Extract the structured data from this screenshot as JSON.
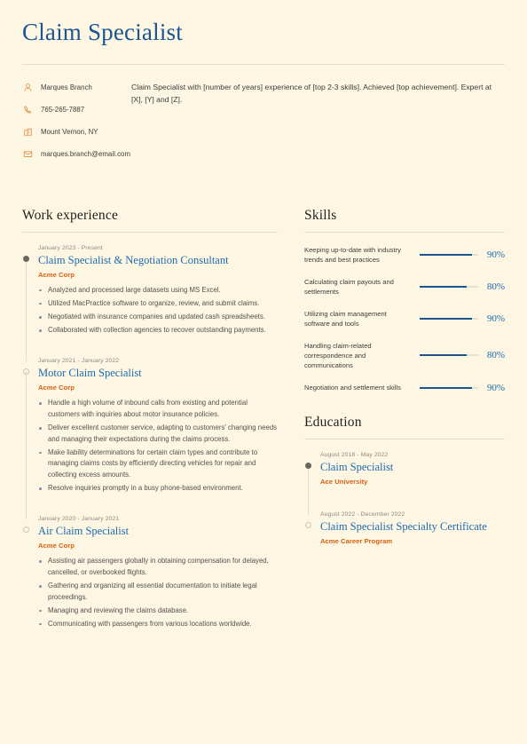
{
  "header": {
    "title": "Claim Specialist",
    "summary": "Claim Specialist with [number of years] experience of [top 2-3 skills]. Achieved [top achievement]. Expert at [X], [Y] and [Z].",
    "contacts": [
      {
        "icon": "person-icon",
        "text": "Marques Branch"
      },
      {
        "icon": "phone-icon",
        "text": "765-265-7887"
      },
      {
        "icon": "location-icon",
        "text": "Mount Vernon, NY"
      },
      {
        "icon": "email-icon",
        "text": "marques.branch@email.com"
      }
    ]
  },
  "work_experience": {
    "heading": "Work experience",
    "entries": [
      {
        "date": "January 2023 - Present",
        "title": "Claim Specialist & Negotiation Consultant",
        "org": "Acme Corp",
        "points": [
          "Analyzed and processed large datasets using MS Excel.",
          "Utilized MacPractice software to organize, review, and submit claims.",
          "Negotiated with insurance companies and updated cash spreadsheets.",
          "Collaborated with collection agencies to recover outstanding payments."
        ]
      },
      {
        "date": "January 2021 - January 2022",
        "title": "Motor Claim Specialist",
        "org": "Acme Corp",
        "points": [
          "Handle a high volume of inbound calls from existing and potential customers with inquiries about motor insurance policies.",
          "Deliver excellent customer service, adapting to customers' changing needs and managing their expectations during the claims process.",
          "Make liability determinations for certain claim types and contribute to managing claims costs by efficiently directing vehicles for repair and collecting excess amounts.",
          "Resolve inquiries promptly in a busy phone-based environment."
        ]
      },
      {
        "date": "January 2020 - January 2021",
        "title": "Air Claim Specialist",
        "org": "Acme Corp",
        "points": [
          "Assisting air passengers globally in obtaining compensation for delayed, cancelled, or overbooked flights.",
          "Gathering and organizing all essential documentation to initiate legal proceedings.",
          "Managing and reviewing the claims database.",
          "Communicating with passengers from various locations worldwide."
        ]
      }
    ]
  },
  "skills": {
    "heading": "Skills",
    "items": [
      {
        "name": "Keeping up-to-date with industry trends and best practices",
        "percent": "90%",
        "value": 90
      },
      {
        "name": "Calculating claim payouts and settlements",
        "percent": "80%",
        "value": 80
      },
      {
        "name": "Utilizing claim management software and tools",
        "percent": "90%",
        "value": 90
      },
      {
        "name": "Handling claim-related correspondence and communications",
        "percent": "80%",
        "value": 80
      },
      {
        "name": "Negotiation and settlement skills",
        "percent": "90%",
        "value": 90
      }
    ]
  },
  "education": {
    "heading": "Education",
    "entries": [
      {
        "date": "August 2018 - May 2022",
        "title": "Claim Specialist",
        "org": "Ace University"
      },
      {
        "date": "August 2022 - December 2022",
        "title": "Claim Specialist Specialty Certificate",
        "org": "Acme Career Program"
      }
    ]
  },
  "colors": {
    "background": "#fdf6e3",
    "title_blue": "#1c5490",
    "entry_blue": "#1c6cb0",
    "org_orange": "#d9600e",
    "rule": "#e7dcc2",
    "body_text": "#3d3d3d"
  }
}
